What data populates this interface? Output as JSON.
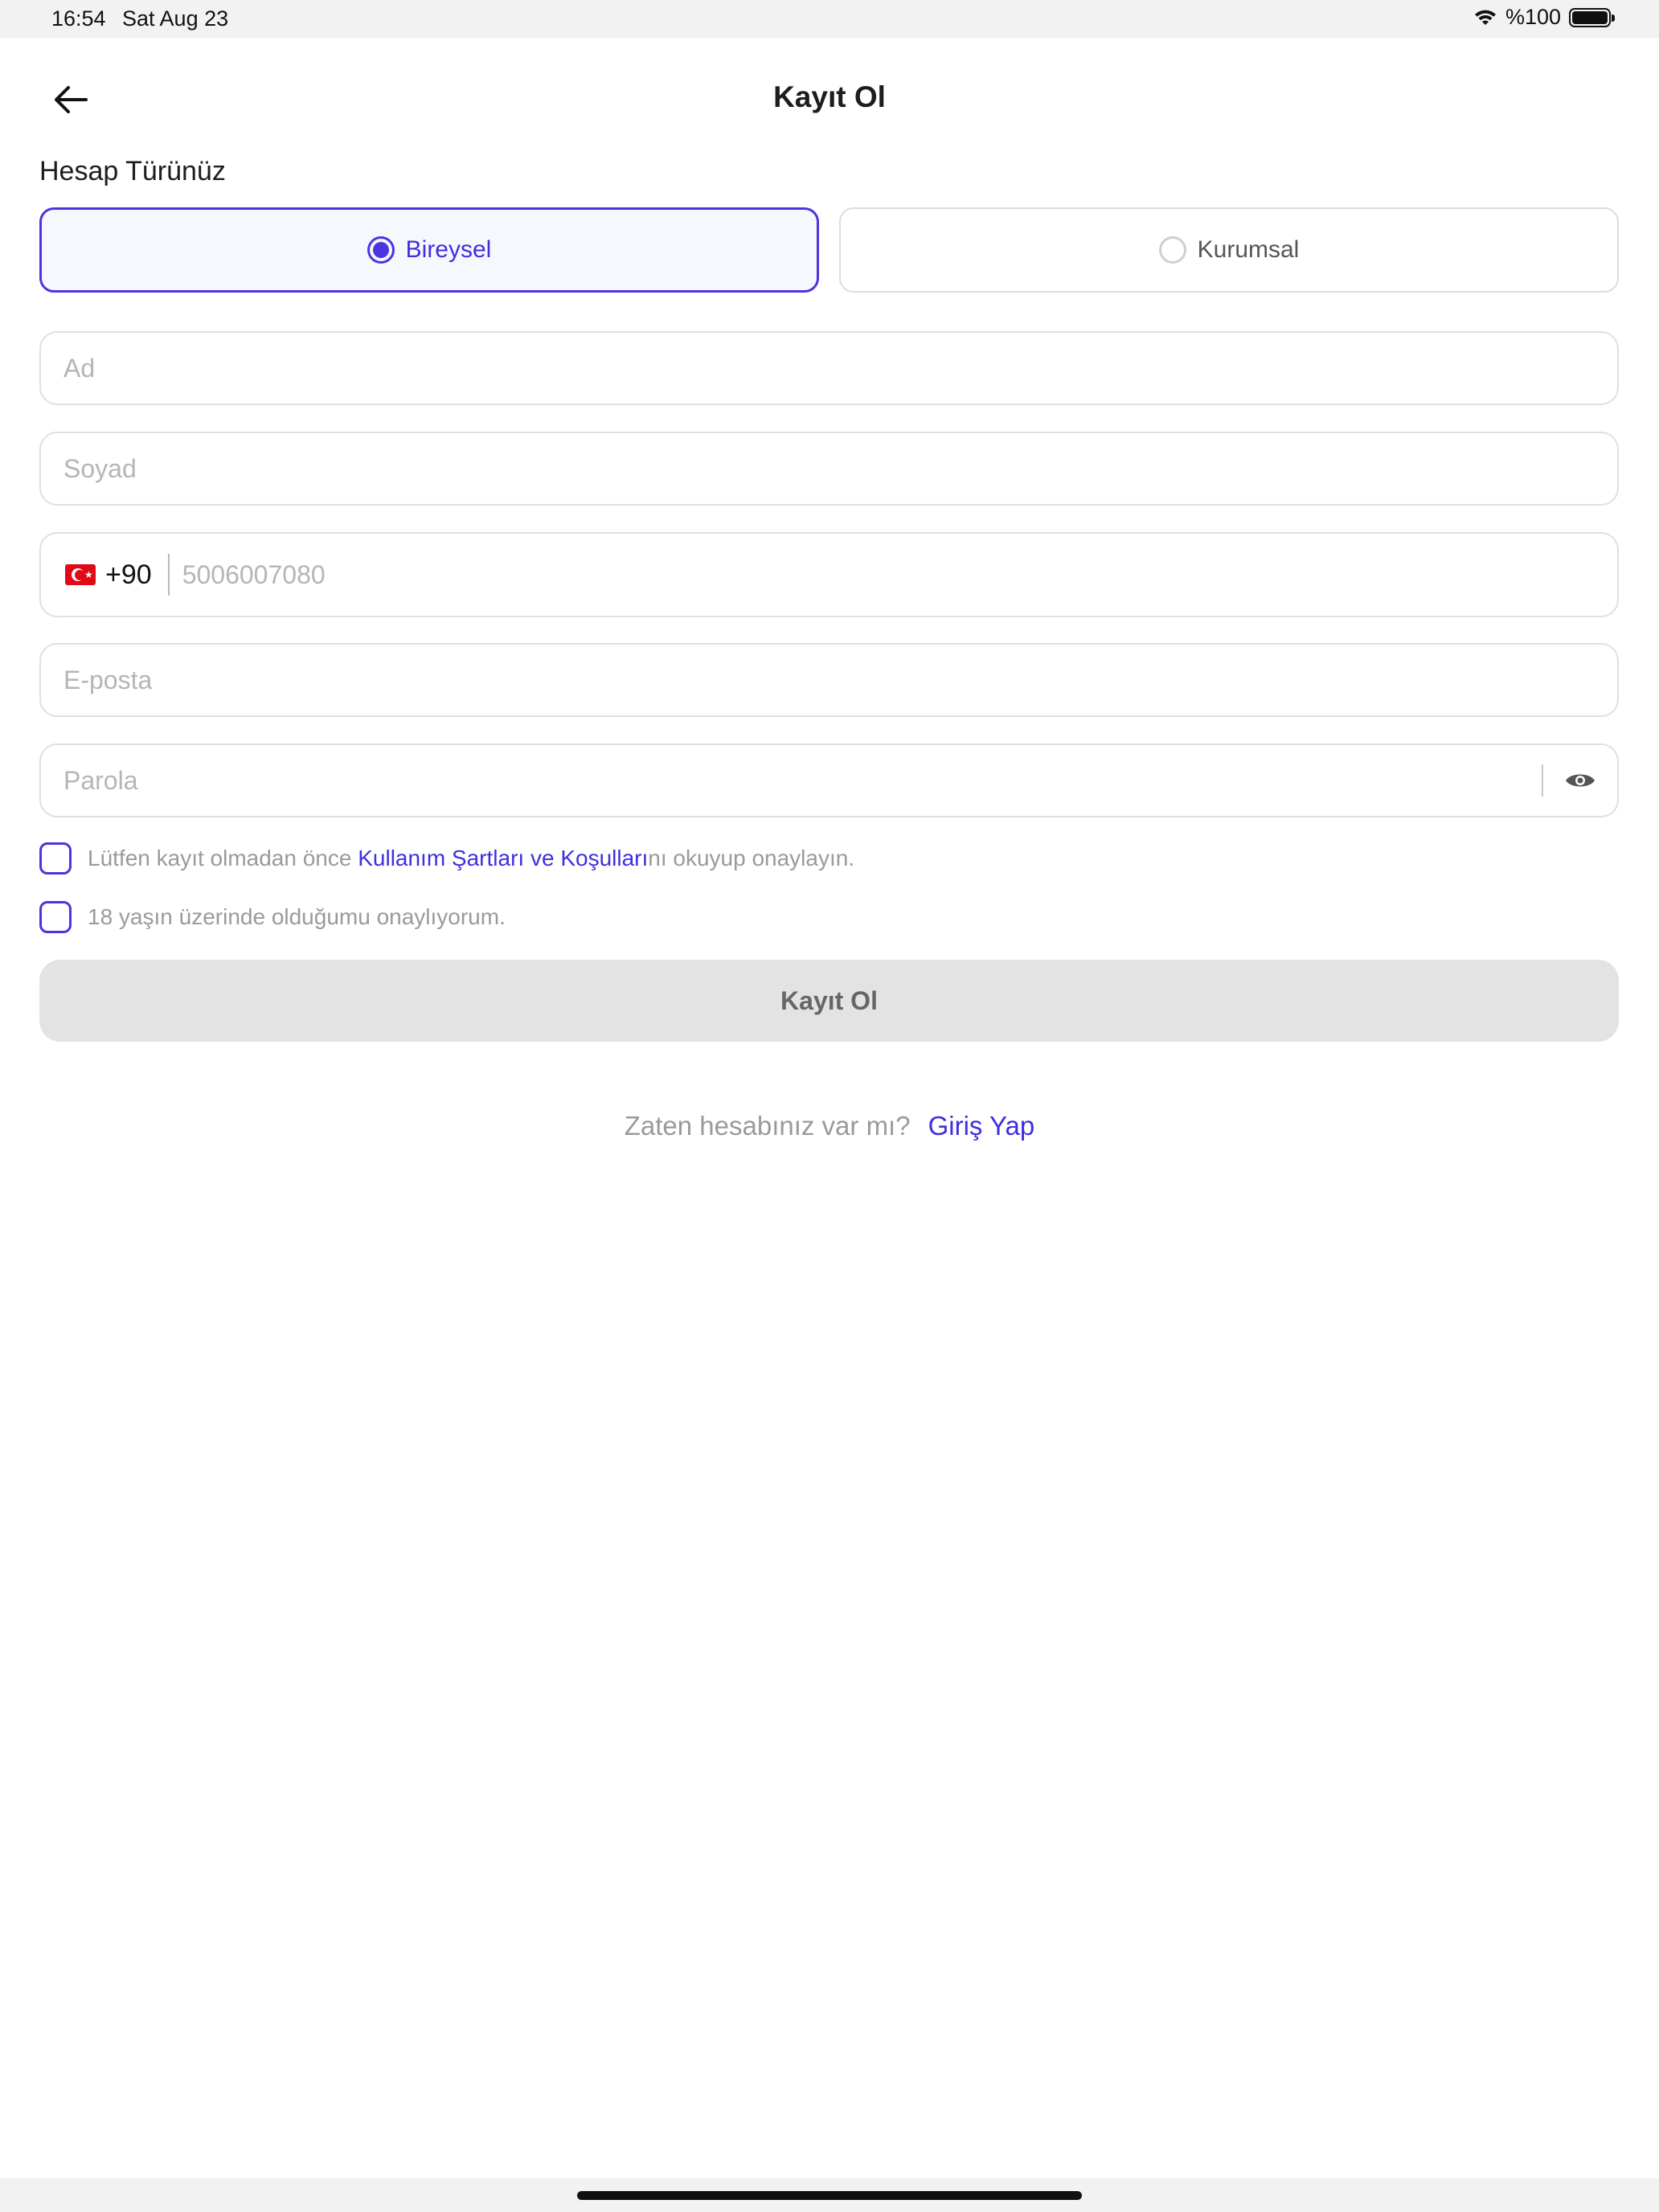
{
  "status_bar": {
    "time": "16:54",
    "date": "Sat Aug 23",
    "battery_text": "%100"
  },
  "header": {
    "title": "Kayıt Ol",
    "back_icon": "arrow-left-icon"
  },
  "account_type": {
    "label": "Hesap Türünüz",
    "options": [
      {
        "label": "Bireysel",
        "selected": true
      },
      {
        "label": "Kurumsal",
        "selected": false
      }
    ]
  },
  "form": {
    "first_name": {
      "placeholder": "Ad",
      "value": ""
    },
    "last_name": {
      "placeholder": "Soyad",
      "value": ""
    },
    "phone": {
      "country_code": "+90",
      "placeholder": "5006007080",
      "value": ""
    },
    "email": {
      "placeholder": "E-posta",
      "value": ""
    },
    "password": {
      "placeholder": "Parola",
      "value": ""
    }
  },
  "consents": {
    "terms": {
      "prefix": "Lütfen kayıt olmadan önce ",
      "link": "Kullanım Şartları ve Koşulları",
      "suffix": "nı okuyup onaylayın.",
      "checked": false
    },
    "age": {
      "text": "18 yaşın üzerinde olduğumu onaylıyorum.",
      "checked": false
    }
  },
  "submit": {
    "label": "Kayıt Ol"
  },
  "footer": {
    "question": "Zaten hesabınız var mı?",
    "login_link": "Giriş Yap"
  },
  "colors": {
    "accent": "#4a35e0",
    "disabled_button": "#e3e3e3",
    "placeholder": "#b5b5b5"
  }
}
